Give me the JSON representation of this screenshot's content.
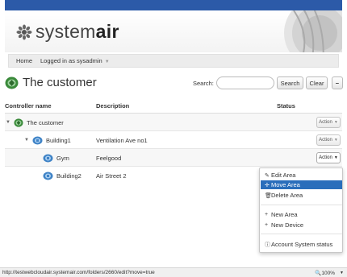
{
  "brand": {
    "name_regular": "system",
    "name_bold": "air"
  },
  "nav": {
    "home": "Home",
    "logged_in": "Logged in as sysadmin"
  },
  "page": {
    "title": "The customer"
  },
  "search": {
    "label": "Search:",
    "placeholder": "",
    "search_button": "Search",
    "clear_button": "Clear",
    "collapse_button": "−"
  },
  "table": {
    "headers": {
      "controller": "Controller name",
      "description": "Description",
      "status": "Status"
    },
    "rows": [
      {
        "name": "The customer",
        "description": "",
        "action": "Action"
      },
      {
        "name": "Building1",
        "description": "Ventilation Ave no1",
        "action": "Action"
      },
      {
        "name": "Gym",
        "description": "Feelgood",
        "action": "Action"
      },
      {
        "name": "Building2",
        "description": "Air Street 2",
        "action": ""
      }
    ]
  },
  "menu": {
    "edit_area": "Edit Area",
    "move_area": "Move Area",
    "delete_area": "Delete Area",
    "new_area": "New Area",
    "new_device": "New Device",
    "account_status": "Account System status"
  },
  "statusbar": {
    "url": "http://testwebcloudair.systemair.com/folders/2660/edit?move=true",
    "zoom": "100%"
  },
  "colors": {
    "top_bar": "#2c5aa8",
    "menu_active": "#2a6ebb",
    "icon_green": "#3a8a3a",
    "icon_blue": "#3f83c6"
  }
}
